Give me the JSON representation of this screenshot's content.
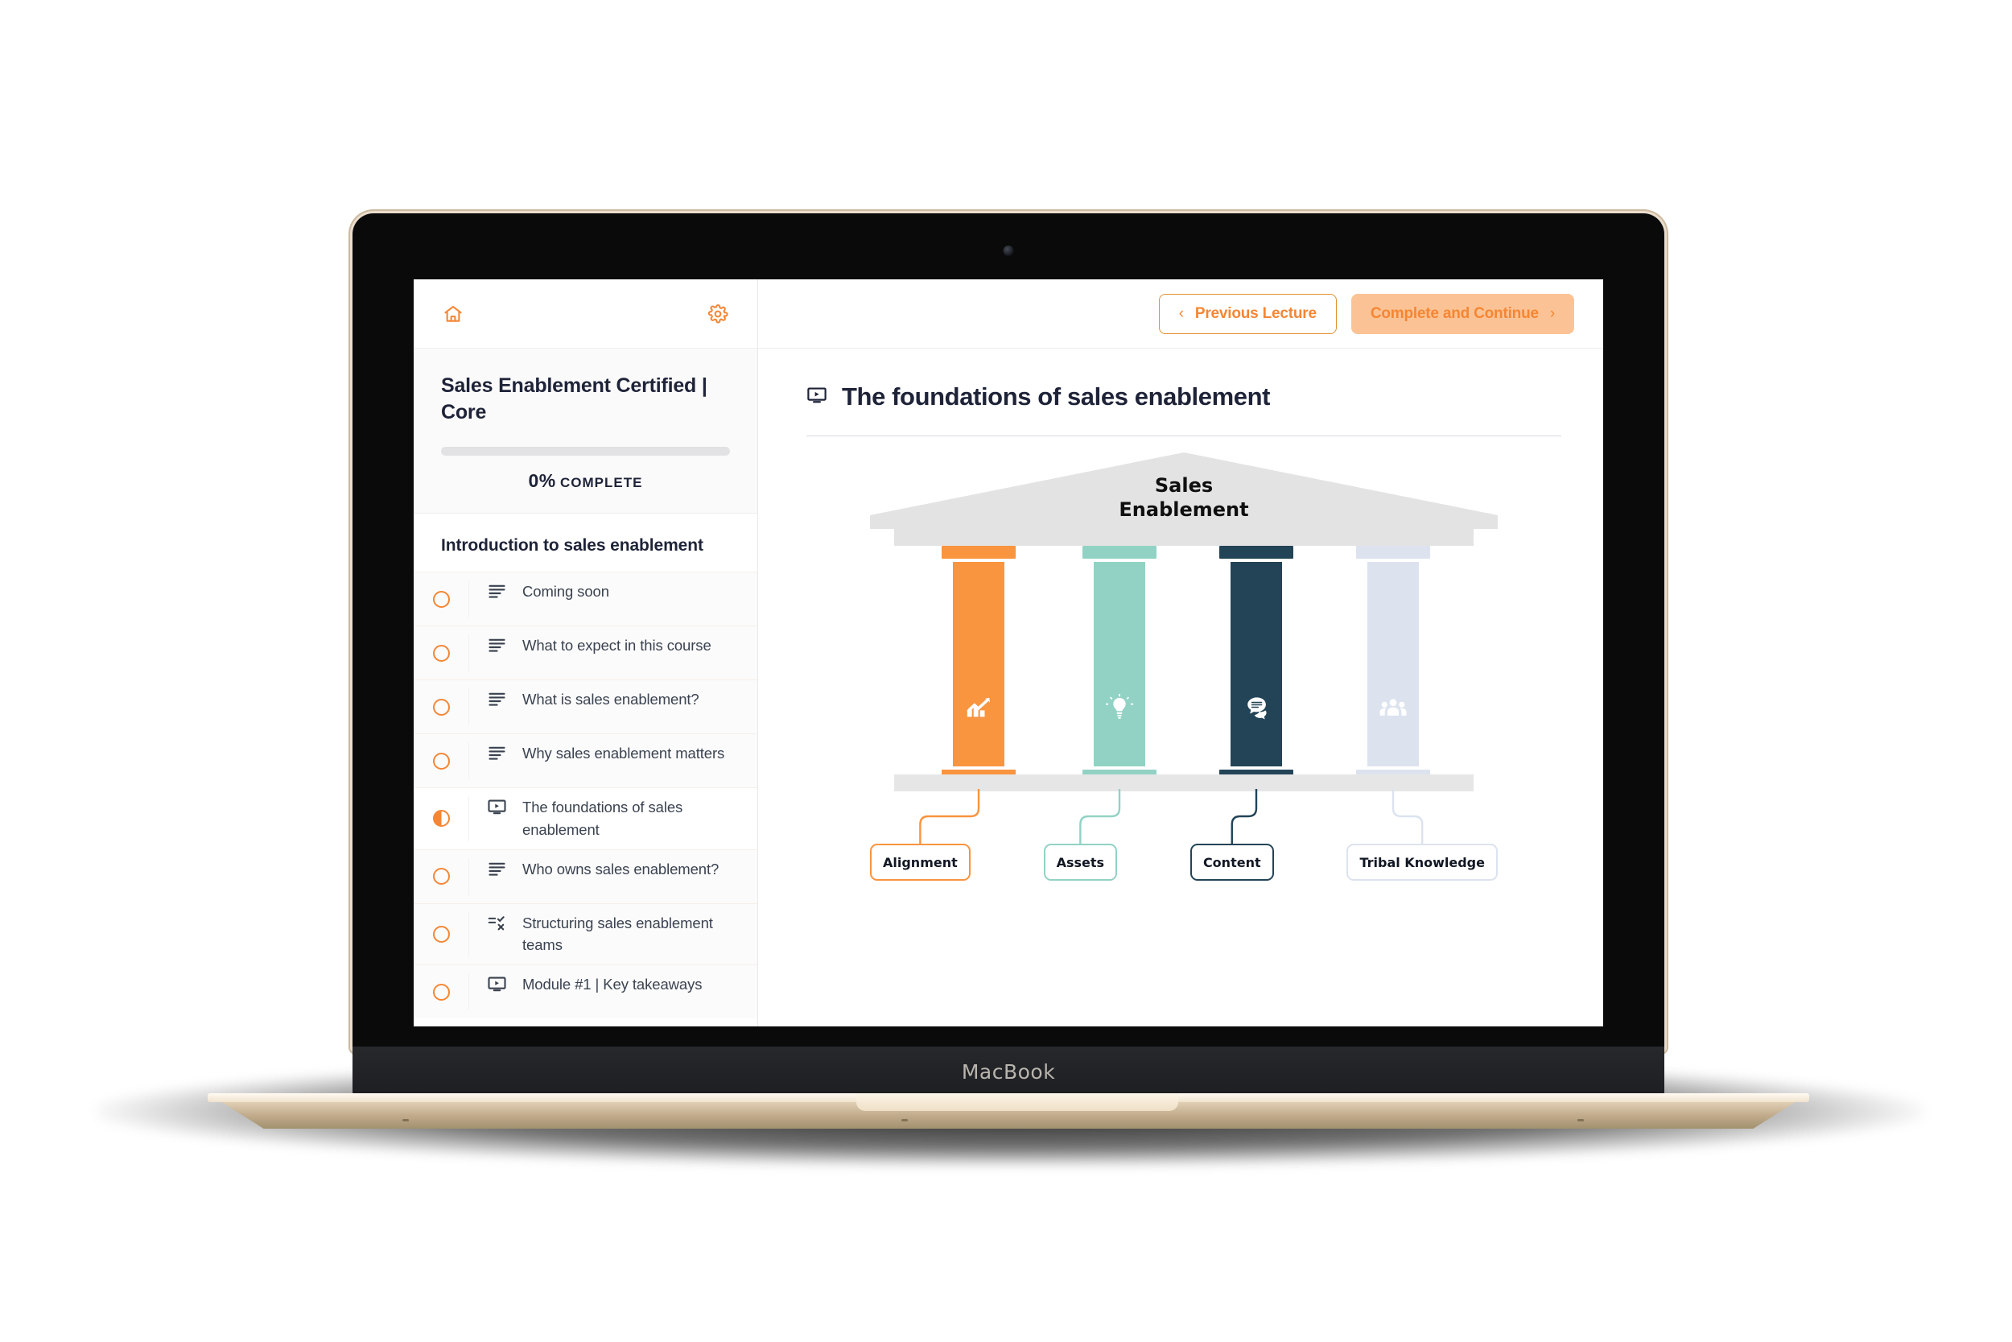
{
  "device": {
    "label": "MacBook"
  },
  "sidebar": {
    "home_icon": "home-icon",
    "settings_icon": "gear-icon",
    "course": {
      "title": "Sales Enablement Certified | Core",
      "progress_percent": "0%",
      "progress_value": 0,
      "progress_suffix": "COMPLETE"
    },
    "section_title": "Introduction to sales enablement",
    "lessons": [
      {
        "label": "Coming soon",
        "icon": "text-lines-icon",
        "status": "not-started",
        "active": false
      },
      {
        "label": "What to expect in this course",
        "icon": "text-lines-icon",
        "status": "not-started",
        "active": false
      },
      {
        "label": "What is sales enablement?",
        "icon": "text-lines-icon",
        "status": "not-started",
        "active": false
      },
      {
        "label": "Why sales enablement matters",
        "icon": "text-lines-icon",
        "status": "not-started",
        "active": false
      },
      {
        "label": "The foundations of sales enablement",
        "icon": "video-icon",
        "status": "in-progress",
        "active": true
      },
      {
        "label": "Who owns sales enablement?",
        "icon": "text-lines-icon",
        "status": "not-started",
        "active": false
      },
      {
        "label": "Structuring sales enablement teams",
        "icon": "quiz-icon",
        "status": "not-started",
        "active": false
      },
      {
        "label": "Module #1 | Key takeaways",
        "icon": "video-icon",
        "status": "not-started",
        "active": false
      }
    ]
  },
  "topbar": {
    "previous_label": "Previous Lecture",
    "previous_chevron": "‹",
    "continue_label": "Complete and Continue",
    "continue_chevron": "›"
  },
  "lecture": {
    "icon": "video-icon",
    "title": "The foundations of sales enablement"
  },
  "diagram": {
    "pediment_line1": "Sales",
    "pediment_line2": "Enablement",
    "pillars": [
      {
        "label": "Alignment",
        "color": "#F9943F",
        "capital_color": "#F9943F",
        "icon": "growth-chart-icon",
        "connector": "bent-left"
      },
      {
        "label": "Assets",
        "color": "#92D2C5",
        "capital_color": "#92D2C5",
        "icon": "lightbulb-icon",
        "connector": "straight"
      },
      {
        "label": "Content",
        "color": "#234457",
        "capital_color": "#234457",
        "icon": "chat-bubble-icon",
        "connector": "straight"
      },
      {
        "label": "Tribal Knowledge",
        "color": "#DCE3EF",
        "capital_color": "#DCE3EF",
        "icon": "people-icon",
        "connector": "bent-right"
      }
    ]
  },
  "colors": {
    "accent_orange": "#F58634",
    "continue_bg": "#FBC395",
    "text_dark": "#1E2338",
    "pediment_gray": "#E3E3E3",
    "plinth_gray": "#E6E6E6"
  }
}
